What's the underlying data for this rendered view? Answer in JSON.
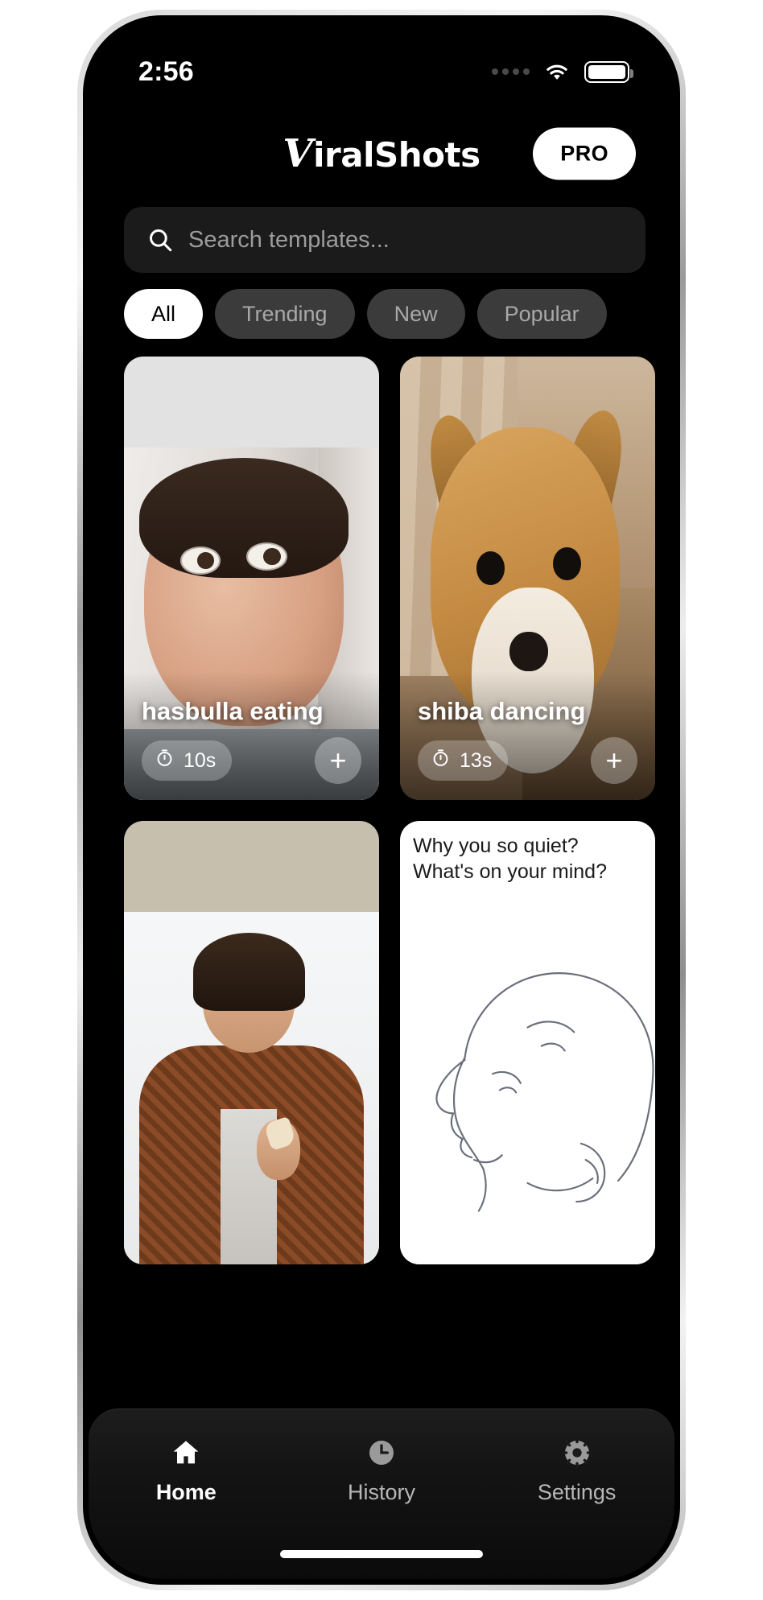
{
  "status_bar": {
    "time": "2:56",
    "signal_icon": "signal-dots-icon",
    "wifi_icon": "wifi-icon",
    "battery_icon": "battery-icon"
  },
  "header": {
    "brand_initial": "V",
    "brand_rest": "iralShots",
    "pro_label": "PRO"
  },
  "search": {
    "placeholder": "Search templates...",
    "value": "",
    "icon": "search-icon"
  },
  "filters": {
    "chips": [
      {
        "label": "All",
        "active": true
      },
      {
        "label": "Trending",
        "active": false
      },
      {
        "label": "New",
        "active": false
      },
      {
        "label": "Popular",
        "active": false
      }
    ]
  },
  "templates": [
    {
      "title": "hasbulla eating",
      "duration": "10s",
      "duration_icon": "stopwatch-icon",
      "add_label": "+"
    },
    {
      "title": "shiba dancing",
      "duration": "13s",
      "duration_icon": "stopwatch-icon",
      "add_label": "+"
    },
    {
      "title": "",
      "duration": "",
      "duration_icon": "stopwatch-icon",
      "add_label": "+"
    },
    {
      "title": "",
      "duration": "",
      "duration_icon": "stopwatch-icon",
      "add_label": "+",
      "caption": "Why you so quiet? What's on your mind?"
    }
  ],
  "tabbar": {
    "items": [
      {
        "label": "Home",
        "icon": "home-icon",
        "active": true
      },
      {
        "label": "History",
        "icon": "clock-icon",
        "active": false
      },
      {
        "label": "Settings",
        "icon": "gear-icon",
        "active": false
      }
    ]
  },
  "colors": {
    "background": "#000000",
    "surface": "#1b1b1b",
    "chip_inactive": "#3b3b3b",
    "accent_on_white": "#000000",
    "text_primary": "#ffffff",
    "text_muted": "#a8a8a8"
  }
}
